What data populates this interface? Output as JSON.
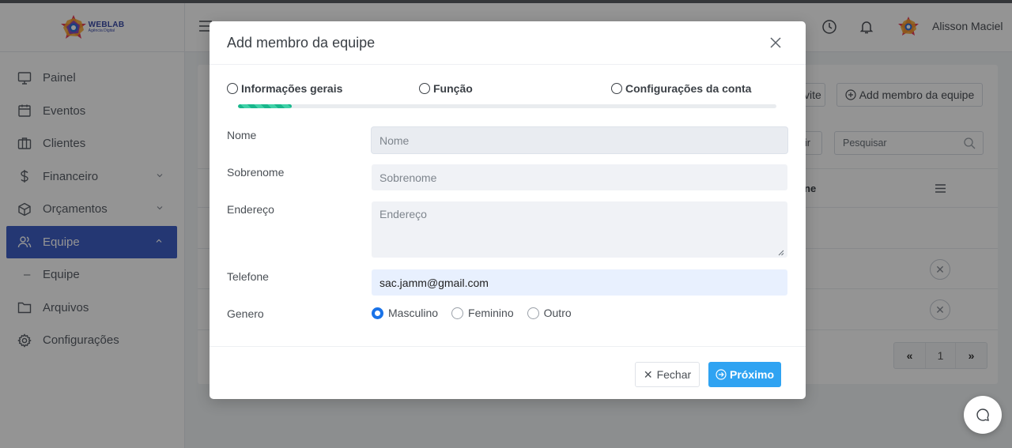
{
  "brand": {
    "name": "WEBLAB",
    "tagline": "Agência Digital"
  },
  "sidebar": {
    "items": [
      {
        "label": "Painel",
        "icon": "monitor-icon"
      },
      {
        "label": "Eventos",
        "icon": "calendar-icon"
      },
      {
        "label": "Clientes",
        "icon": "columns-icon"
      },
      {
        "label": "Financeiro",
        "icon": "dollar-icon",
        "expandable": true
      },
      {
        "label": "Orçamentos",
        "icon": "box-icon",
        "expandable": true
      },
      {
        "label": "Equipe",
        "icon": "users-icon",
        "expandable": true,
        "active": true
      },
      {
        "label": "Equipe",
        "icon": "dash",
        "sub": true
      },
      {
        "label": "Arquivos",
        "icon": "folder-icon"
      },
      {
        "label": "Configurações",
        "icon": "gear-icon"
      }
    ]
  },
  "header": {
    "user_name": "Alisson Maciel"
  },
  "background": {
    "invite_button": "vite",
    "add_member_button": "Add membro da equipe",
    "filter_button": "ir",
    "search_placeholder": "Pesquisar",
    "column_header": "ne",
    "pager": {
      "prev": "«",
      "page": "1",
      "next": "»"
    }
  },
  "modal": {
    "title": "Add membro da equipe",
    "steps": [
      "Informações gerais",
      "Função",
      "Configurações da conta"
    ],
    "progress": 0.1,
    "fields": {
      "nome": {
        "label": "Nome",
        "placeholder": "Nome",
        "value": ""
      },
      "sobrenome": {
        "label": "Sobrenome",
        "placeholder": "Sobrenome",
        "value": ""
      },
      "endereco": {
        "label": "Endereço",
        "placeholder": "Endereço",
        "value": ""
      },
      "telefone": {
        "label": "Telefone",
        "placeholder": "",
        "value": "sac.jamm@gmail.com"
      },
      "genero": {
        "label": "Genero",
        "options": [
          "Masculino",
          "Feminino",
          "Outro"
        ],
        "selected": "Masculino"
      }
    },
    "close_button": "Fechar",
    "next_button": "Próximo"
  },
  "colors": {
    "accent": "#3f5fc7",
    "primary_button": "#2fa3f2",
    "progress": "#19b78c",
    "radio_on": "#1a73e8"
  }
}
